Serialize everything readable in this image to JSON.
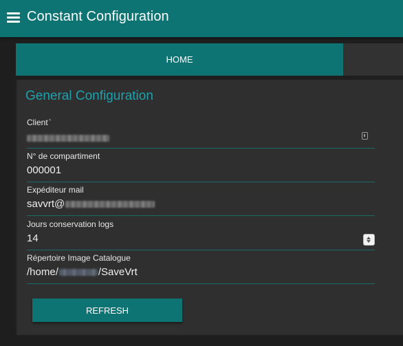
{
  "header": {
    "title": "Constant Configuration",
    "menu_icon": "menu-icon"
  },
  "tabs": [
    {
      "label": "HOME",
      "active": true
    }
  ],
  "section": {
    "title": "General Configuration"
  },
  "fields": {
    "client": {
      "label": "Client",
      "required_mark": "*",
      "value": ""
    },
    "compartment": {
      "label": "N° de compartiment",
      "value": "000001"
    },
    "mail": {
      "label": "Expéditeur mail",
      "value_prefix": "savvrt@"
    },
    "logs": {
      "label": "Jours conservation logs",
      "value": "14"
    },
    "catalog": {
      "label": "Répertoire Image Catalogue",
      "value_prefix": "/home/",
      "value_suffix": "/SaveVrt"
    }
  },
  "actions": {
    "refresh_label": "REFRESH"
  },
  "colors": {
    "accent": "#0e7373",
    "title_accent": "#1da1ad",
    "background": "#1e1e1e",
    "panel": "#2f2f2f"
  }
}
